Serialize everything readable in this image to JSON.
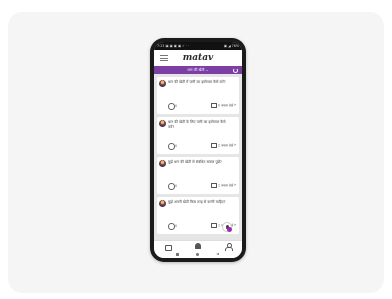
{
  "status_bar": {
    "left": "7:23 ▣ ▣ ▣ ▣ ✓ · ·",
    "right": "▣ ◢ 78%"
  },
  "app": {
    "brand": "matav",
    "menu_icon": "hamburger-icon",
    "refresh_icon": "refresh-icon"
  },
  "filter": {
    "label": "धान की खेती ⌄"
  },
  "questions": [
    {
      "text": "धान की खेती में पानी का इस्तेमाल कैसे करें?",
      "likes": "0",
      "answers": "0 जवाब देखें"
    },
    {
      "text": "धान की खेती के लिए पानी का इस्तेमाल कैसे करें?",
      "likes": "0",
      "answers": "2 जवाब देखें"
    },
    {
      "text": "मुझे धान की खेती से संबंधित सवाल पूछें?",
      "likes": "0",
      "answers": "1 जवाब देखें"
    },
    {
      "text": "मुझे अपनी खेती किस तरह से करनी चाहिए?",
      "likes": "0",
      "answers": "1 जवाब देखें"
    }
  ],
  "tabs": {
    "items": [
      "thumbs-up-icon",
      "home-icon",
      "profile-icon"
    ]
  },
  "system_nav": {
    "items": [
      "square-icon",
      "circle-icon",
      "back-triangle-icon"
    ]
  }
}
